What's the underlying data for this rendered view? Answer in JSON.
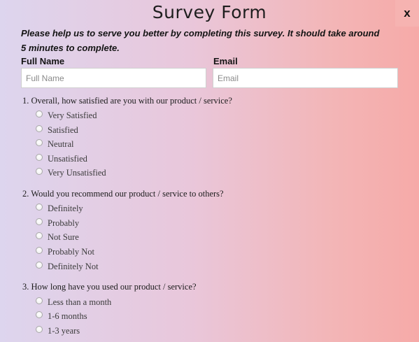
{
  "form": {
    "title": "Survey Form",
    "close_label": "x",
    "intro": "Please help us to serve you better by completing this survey. It should take around 5 minutes to complete."
  },
  "fields": {
    "full_name": {
      "label": "Full Name",
      "placeholder": "Full Name",
      "value": ""
    },
    "email": {
      "label": "Email",
      "placeholder": "Email",
      "value": ""
    }
  },
  "questions": [
    {
      "text": "1. Overall, how satisfied are you with our product / service?",
      "options": [
        "Very Satisfied",
        "Satisfied",
        "Neutral",
        "Unsatisfied",
        "Very Unsatisfied"
      ]
    },
    {
      "text": "2. Would you recommend our product / service to others?",
      "options": [
        "Definitely",
        "Probably",
        "Not Sure",
        "Probably Not",
        "Definitely Not"
      ]
    },
    {
      "text": "3. How long have you used our product / service?",
      "options": [
        "Less than a month",
        "1-6 months",
        "1-3 years"
      ]
    }
  ]
}
